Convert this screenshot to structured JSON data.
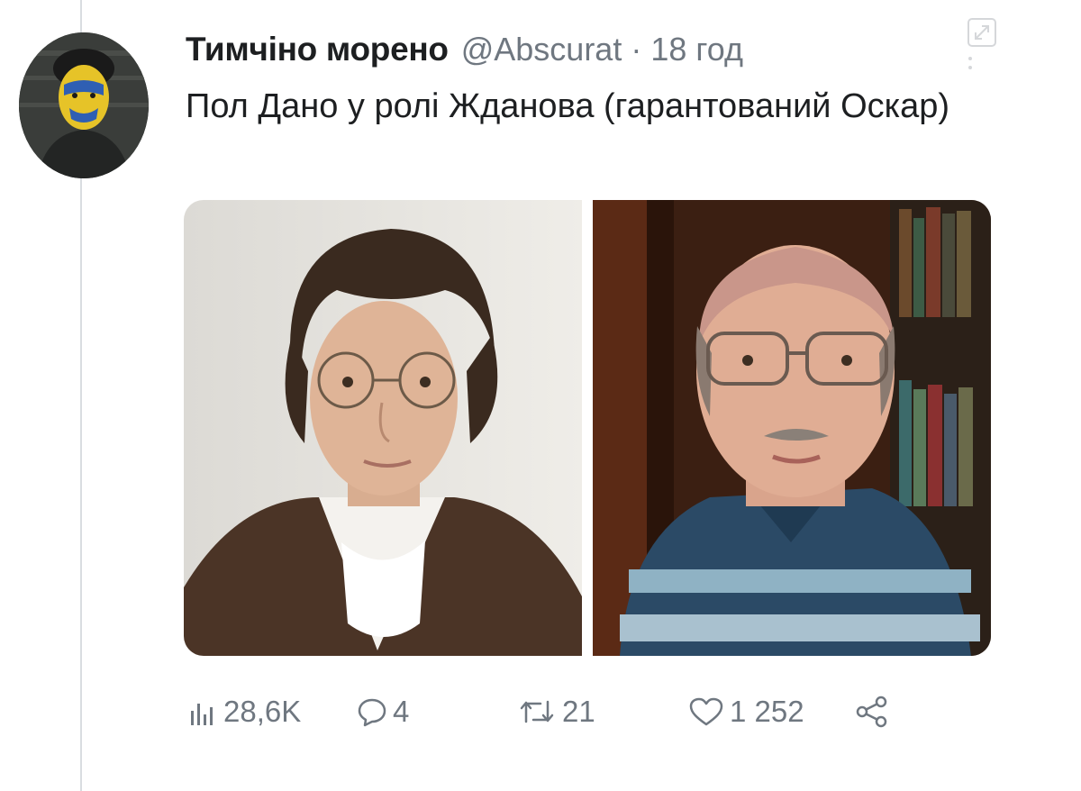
{
  "tweet": {
    "display_name": "Тимчіно морено",
    "handle": "@Abscurat",
    "separator": "·",
    "time": "18 год",
    "text": "Пол Дано у ролі Жданова (гарантований Оскар)"
  },
  "media": {
    "images": [
      {
        "icon": "portrait-photo-icon"
      },
      {
        "icon": "portrait-photo-icon"
      }
    ]
  },
  "actions": {
    "views": "28,6K",
    "replies": "4",
    "retweets": "21",
    "likes": "1 252"
  },
  "colors": {
    "text": "#1d1f21",
    "muted": "#6f7780",
    "thread_line": "#d9dde1"
  }
}
